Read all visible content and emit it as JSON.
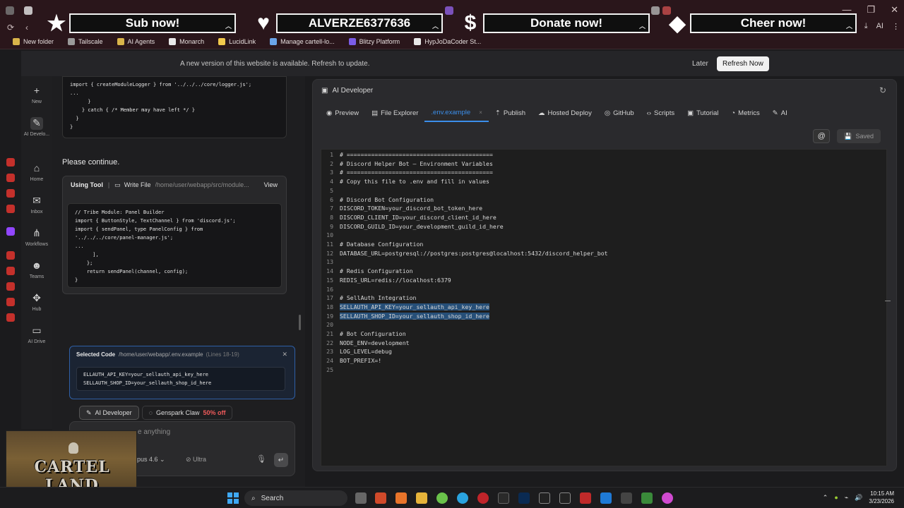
{
  "bookmarks": [
    {
      "label": "New folder",
      "color": "#d9b44a"
    },
    {
      "label": "Tailscale",
      "color": "#9a9a9a"
    },
    {
      "label": "AI Agents",
      "color": "#d9b44a"
    },
    {
      "label": "Monarch",
      "color": "#e8e8e8"
    },
    {
      "label": "LucidLink",
      "color": "#f2c94c"
    },
    {
      "label": "Manage cartell-lo...",
      "color": "#6aa4e8"
    },
    {
      "label": "Blitzy Platform",
      "color": "#7b5ce6"
    },
    {
      "label": "HypJoDaCoder St...",
      "color": "#e8e8e8"
    }
  ],
  "addr_right": {
    "ai": "AI"
  },
  "overlay": {
    "sub": "Sub now!",
    "follower": "ALVERZE6377636",
    "donate": "Donate now!",
    "cheer": "Cheer now!"
  },
  "update_bar": {
    "message": "A new version of this website is available. Refresh to update.",
    "later": "Later",
    "refresh": "Refresh Now"
  },
  "nav": [
    {
      "icon": "+",
      "label": "New"
    },
    {
      "icon": "✎",
      "label": "AI Develo..."
    },
    {
      "icon": "⌂",
      "label": "Home"
    },
    {
      "icon": "✉",
      "label": "Inbox"
    },
    {
      "icon": "⋔",
      "label": "Workflows"
    },
    {
      "icon": "☻",
      "label": "Teams"
    },
    {
      "icon": "✥",
      "label": "Hub"
    },
    {
      "icon": "▭",
      "label": "AI Drive"
    }
  ],
  "chat": {
    "code1": "import { createModuleLogger } from '../../../core/logger.js';\n...\n      }\n    } catch { /* Member may have left */ }\n  }\n}",
    "continue": "Please continue.",
    "tool": {
      "using": "Using Tool",
      "action": "Write File",
      "path": "/home/user/webapp/src/module...",
      "view": "View",
      "code": "// Tribe Module: Panel Builder\nimport { ButtonStyle, TextChannel } from 'discord.js';\nimport { sendPanel, type PanelConfig } from\n'../../../core/panel-manager.js';\n...\n      ],\n    };\n    return sendPanel(channel, config);\n}"
    },
    "selected": {
      "title": "Selected Code",
      "path": "/home/user/webapp/.env.example",
      "lines": "(Lines 18-19)",
      "code": "ELLAUTH_API_KEY=your_sellauth_api_key_here\nSELLAUTH_SHOP_ID=your_sellauth_shop_id_here"
    },
    "modes": {
      "dev": "AI Developer",
      "claw": "Genspark Claw",
      "discount": "50% off"
    },
    "input": {
      "placeholder": "e anything",
      "model": "pus 4.6 ⌄",
      "ultra": "Ultra"
    }
  },
  "panel": {
    "title": "AI Developer",
    "tabs": [
      {
        "icon": "◉",
        "label": "Preview"
      },
      {
        "icon": "▤",
        "label": "File Explorer"
      },
      {
        "icon": "",
        "label": ".env.example"
      },
      {
        "icon": "⇡",
        "label": "Publish"
      },
      {
        "icon": "☁",
        "label": "Hosted Deploy"
      },
      {
        "icon": "◎",
        "label": "GitHub"
      },
      {
        "icon": "‹›",
        "label": "Scripts"
      },
      {
        "icon": "▣",
        "label": "Tutorial"
      },
      {
        "icon": "◔",
        "label": "Metrics"
      },
      {
        "icon": "✎",
        "label": "AI"
      }
    ],
    "close_glyph": "×",
    "at_label": "@",
    "saved": "Saved"
  },
  "editor": {
    "lines": [
      "# ==========================================",
      "# Discord Helper Bot – Environment Variables",
      "# ==========================================",
      "# Copy this file to .env and fill in values",
      "",
      "# Discord Bot Configuration",
      "DISCORD_TOKEN=your_discord_bot_token_here",
      "DISCORD_CLIENT_ID=your_discord_client_id_here",
      "DISCORD_GUILD_ID=your_development_guild_id_here",
      "",
      "# Database Configuration",
      "DATABASE_URL=postgresql://postgres:postgres@localhost:5432/discord_helper_bot",
      "",
      "# Redis Configuration",
      "REDIS_URL=redis://localhost:6379",
      "",
      "# SellAuth Integration",
      "SELLAUTH_API_KEY=your_sellauth_api_key_here",
      "SELLAUTH_SHOP_ID=your_sellauth_shop_id_here",
      "",
      "# Bot Configuration",
      "NODE_ENV=development",
      "LOG_LEVEL=debug",
      "BOT_PREFIX=!",
      ""
    ],
    "highlighted": [
      18,
      19
    ]
  },
  "webcam": {
    "logo": "CARTEL LAND"
  },
  "taskbar": {
    "search": "Search",
    "time": "10:15 AM",
    "date": "3/23/2026"
  }
}
